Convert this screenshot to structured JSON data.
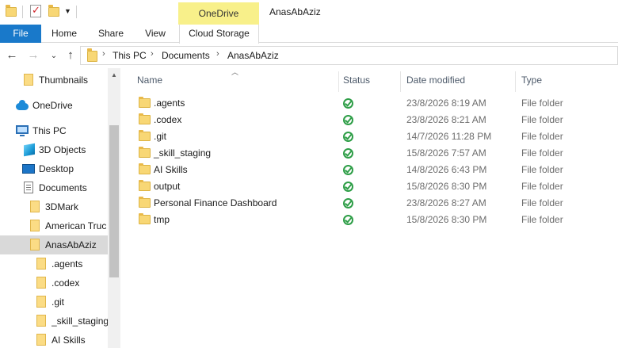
{
  "window": {
    "title": "AnasAbAziz"
  },
  "contextual_tab_group": "OneDrive",
  "ribbon": {
    "tabs": [
      "File",
      "Home",
      "Share",
      "View",
      "Cloud Storage"
    ]
  },
  "address": {
    "crumbs": [
      "This PC",
      "Documents",
      "AnasAbAziz"
    ]
  },
  "nav": {
    "items": [
      {
        "label": "Thumbnails",
        "icon": "folder-icon"
      },
      {
        "label": "OneDrive",
        "icon": "onedrive-cloud-icon"
      },
      {
        "label": "This PC",
        "icon": "this-pc-icon"
      },
      {
        "label": "3D Objects",
        "icon": "3d-objects-icon"
      },
      {
        "label": "Desktop",
        "icon": "desktop-icon"
      },
      {
        "label": "Documents",
        "icon": "documents-icon"
      },
      {
        "label": "3DMark",
        "icon": "folder-icon"
      },
      {
        "label": "American Truc",
        "icon": "folder-icon"
      },
      {
        "label": "AnasAbAziz",
        "icon": "folder-icon"
      },
      {
        "label": ".agents",
        "icon": "folder-icon"
      },
      {
        "label": ".codex",
        "icon": "folder-icon"
      },
      {
        "label": ".git",
        "icon": "folder-icon"
      },
      {
        "label": "_skill_staging",
        "icon": "folder-icon"
      },
      {
        "label": "AI Skills",
        "icon": "folder-icon"
      }
    ]
  },
  "columns": {
    "name": "Name",
    "status": "Status",
    "date": "Date modified",
    "type": "Type"
  },
  "files": [
    {
      "name": ".agents",
      "date": "23/8/2026 8:19 AM",
      "type": "File folder"
    },
    {
      "name": ".codex",
      "date": "23/8/2026 8:21 AM",
      "type": "File folder"
    },
    {
      "name": ".git",
      "date": "14/7/2026 11:28 PM",
      "type": "File folder"
    },
    {
      "name": "_skill_staging",
      "date": "15/8/2026 7:57 AM",
      "type": "File folder"
    },
    {
      "name": "AI Skills",
      "date": "14/8/2026 6:43 PM",
      "type": "File folder"
    },
    {
      "name": "output",
      "date": "15/8/2026 8:30 PM",
      "type": "File folder"
    },
    {
      "name": "Personal Finance Dashboard",
      "date": "23/8/2026 8:27 AM",
      "type": "File folder"
    },
    {
      "name": "tmp",
      "date": "15/8/2026 8:30 PM",
      "type": "File folder"
    }
  ],
  "colors": {
    "file_tab": "#1979ca",
    "onedrive_context": "#f8f08a",
    "status_ok": "#2e9e47",
    "selected_row": "#d9d9d9"
  }
}
